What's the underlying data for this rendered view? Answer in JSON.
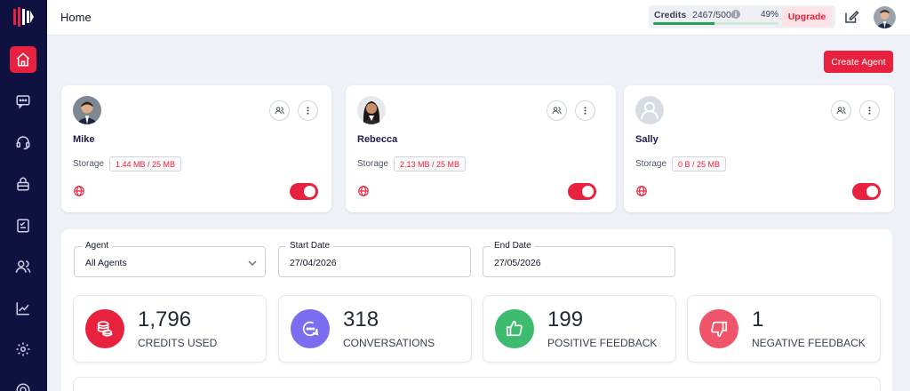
{
  "header": {
    "title": "Home",
    "credits_label": "Credits",
    "credits_value": "2467/5000",
    "credits_percent": "49%",
    "credits_fraction": 0.49,
    "upgrade_label": "Upgrade"
  },
  "sidebar": {
    "items": [
      {
        "icon": "home-icon",
        "active": true
      },
      {
        "icon": "chat-icon"
      },
      {
        "icon": "headset-icon"
      },
      {
        "icon": "basket-icon"
      },
      {
        "icon": "checklist-icon"
      },
      {
        "icon": "users-icon"
      },
      {
        "icon": "analytics-icon"
      },
      {
        "icon": "settings-icon"
      },
      {
        "icon": "help-icon"
      }
    ]
  },
  "create_agent_label": "Create Agent",
  "agents": [
    {
      "name": "Mike",
      "storage_label": "Storage",
      "storage": "1.44 MB / 25 MB",
      "enabled": true
    },
    {
      "name": "Rebecca",
      "storage_label": "Storage",
      "storage": "2.13 MB / 25 MB",
      "enabled": true
    },
    {
      "name": "Sally",
      "storage_label": "Storage",
      "storage": "0 B / 25 MB",
      "enabled": true
    }
  ],
  "filters": {
    "agent_label": "Agent",
    "agent_value": "All Agents",
    "start_label": "Start Date",
    "start_value": "27/04/2026",
    "end_label": "End Date",
    "end_value": "27/05/2026"
  },
  "stats": [
    {
      "value": "1,796",
      "label": "CREDITS USED",
      "color": "#e8213e"
    },
    {
      "value": "318",
      "label": "CONVERSATIONS",
      "color": "#7c6cf0"
    },
    {
      "value": "199",
      "label": "POSITIVE FEEDBACK",
      "color": "#3dbb6e"
    },
    {
      "value": "1",
      "label": "NEGATIVE FEEDBACK",
      "color": "#f0546a"
    }
  ]
}
